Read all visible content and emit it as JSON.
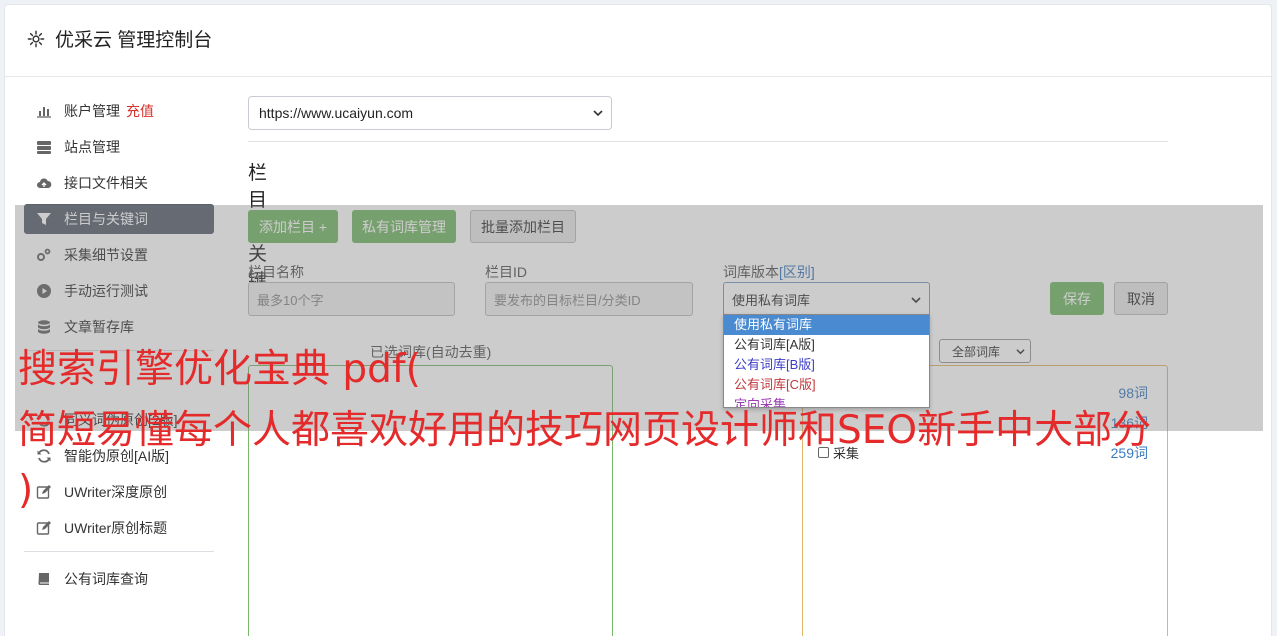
{
  "header": {
    "title": "优采云 管理控制台"
  },
  "sidebar": {
    "items": [
      {
        "label": "账户管理",
        "extra": "充值",
        "icon": "bar-chart-icon"
      },
      {
        "label": "站点管理",
        "icon": "server-icon"
      },
      {
        "label": "接口文件相关",
        "icon": "cloud-upload-icon"
      },
      {
        "label": "栏目与关键词",
        "icon": "filter-icon",
        "active": true
      },
      {
        "label": "采集细节设置",
        "icon": "gears-icon"
      },
      {
        "label": "手动运行测试",
        "icon": "play-circle-icon"
      },
      {
        "label": "文章暂存库",
        "icon": "database-icon"
      }
    ],
    "items2": [
      {
        "label": "同义词伪原创[2版]",
        "icon": "refresh-icon"
      },
      {
        "label": "智能伪原创[AI版]",
        "icon": "refresh-icon"
      },
      {
        "label": "UWriter深度原创",
        "icon": "edit-icon"
      },
      {
        "label": "UWriter原创标题",
        "icon": "edit-icon"
      }
    ],
    "items3": [
      {
        "label": "公有词库查询",
        "icon": "book-icon"
      }
    ]
  },
  "main": {
    "site_select": "https://www.ucaiyun.com",
    "section_title": "栏目与关键词",
    "buttons": {
      "add_column": "添加栏目 +",
      "private_lib": "私有词库管理",
      "batch_add": "批量添加栏目"
    },
    "form": {
      "name_label": "栏目名称",
      "name_placeholder": "最多10个字",
      "id_label": "栏目ID",
      "id_placeholder": "要发布的目标栏目/分类ID",
      "lib_label": "词库版本",
      "lib_label_link": "[区别]",
      "lib_value": "使用私有词库",
      "save": "保存",
      "cancel": "取消"
    },
    "dropdown": [
      {
        "label": "使用私有词库",
        "color": "#ffffff",
        "selected": true
      },
      {
        "label": "公有词库[A版]",
        "color": "#333333"
      },
      {
        "label": "公有词库[B版]",
        "color": "#3c3cc8"
      },
      {
        "label": "公有词库[C版]",
        "color": "#c0393b"
      },
      {
        "label": "定向采集",
        "color": "#9b3fb5"
      }
    ],
    "selected_lib_label": "已选词库(自动去重)",
    "all_lib_select": "全部词库",
    "counts": [
      "98词",
      "136词",
      "259词"
    ],
    "checkbox_label": "采集"
  },
  "watermark": {
    "line1": "搜索引擎优化宝典 pdf(",
    "line2": "简短易懂每个人都喜欢好用的技巧网页设计师和SEO新手中大部分",
    "line3": ")"
  }
}
